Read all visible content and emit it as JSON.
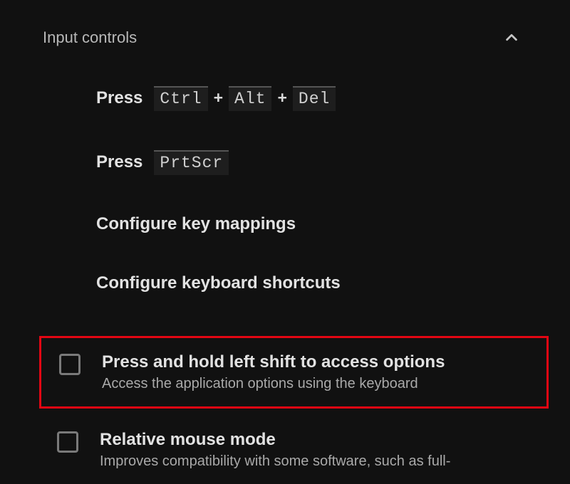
{
  "section": {
    "title": "Input controls"
  },
  "items": {
    "press_cad": {
      "label": "Press",
      "keys": [
        "Ctrl",
        "Alt",
        "Del"
      ],
      "sep": "+"
    },
    "press_prtscr": {
      "label": "Press",
      "keys": [
        "PrtScr"
      ]
    },
    "configure_mappings": {
      "label": "Configure key mappings"
    },
    "configure_shortcuts": {
      "label": "Configure keyboard shortcuts"
    }
  },
  "options": {
    "shift_access": {
      "title": "Press and hold left shift to access options",
      "subtitle": "Access the application options using the keyboard",
      "checked": false
    },
    "relative_mouse": {
      "title": "Relative mouse mode",
      "subtitle": "Improves compatibility with some software, such as full-",
      "checked": false
    }
  }
}
